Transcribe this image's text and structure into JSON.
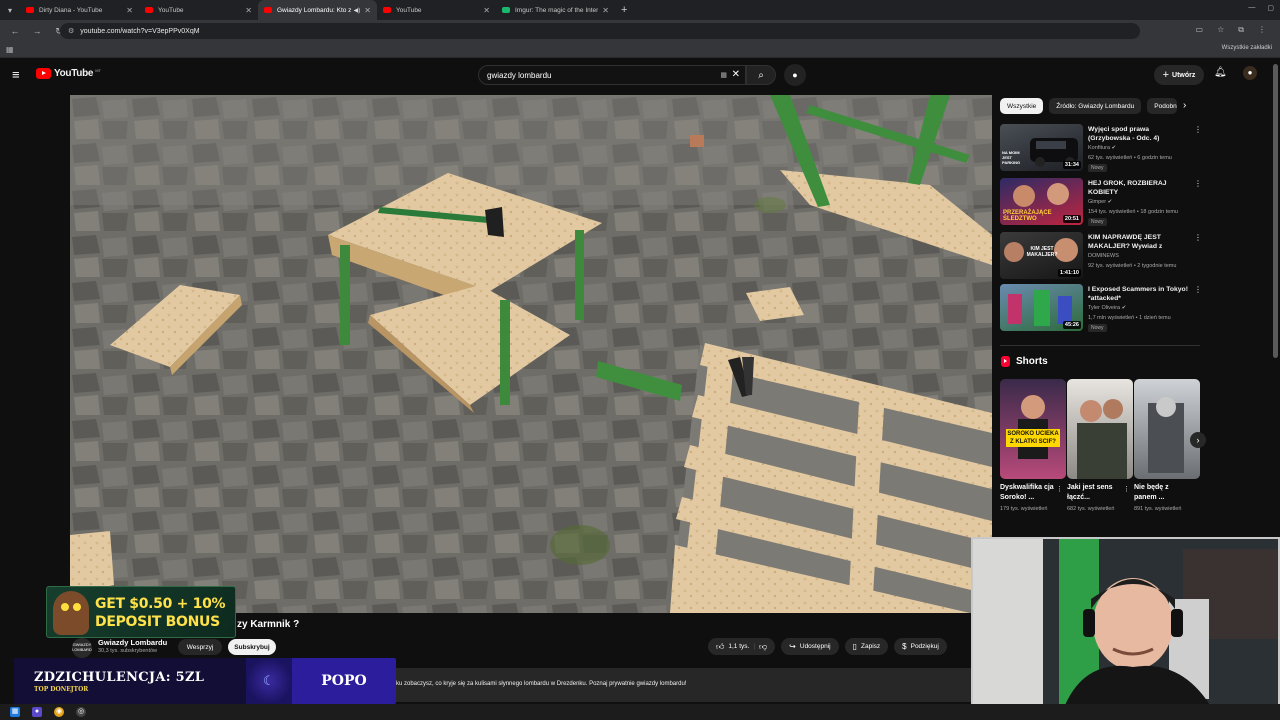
{
  "browser": {
    "tabs": [
      {
        "title": "Dirty Diana - YouTube",
        "active": false
      },
      {
        "title": "YouTube",
        "active": false
      },
      {
        "title": "Gwiazdy Lombardu: Kto zb",
        "active": true
      },
      {
        "title": "YouTube",
        "active": false
      },
      {
        "title": "Imgur: The magic of the Interne",
        "active": false
      }
    ],
    "new_tab": "+",
    "url": "youtube.com/watch?v=V3epPPv0XqM",
    "bookmarks_all": "Wszystkie zakładki"
  },
  "header": {
    "logo_text": "YouTube",
    "logo_country": "MT",
    "search_value": "gwiazdy lombardu",
    "create_label": "Utwórz"
  },
  "video": {
    "title": "zy Karmnik ?",
    "channel_name": "Gwiazdy Lombardu",
    "channel_subs": "30,3 tys. subskrybentów",
    "channel_avatar_text": "GWIAZDY LOMBARDU",
    "support_label": "Wesprzyj",
    "subscribe_label": "Subskrybuj",
    "like_count": "1,1 tys.",
    "share_label": "Udostępnij",
    "save_label": "Zapisz",
    "thanks_label": "Podziękuj",
    "description": "ku zobaczysz, co kryje się za kulisami słynnego lombardu w Drezdenku. Poznaj prywatnie gwiazdy lombardu!"
  },
  "overlays": {
    "promo_line1": "GET $0.50 + 10%",
    "promo_line2": "DEPOSIT BONUS",
    "donor_amount": "ZDZICHULENCJA: 5ZL",
    "donor_tag": "TOP DONEJTOR",
    "donor_name": "POPO"
  },
  "sidebar": {
    "chips": [
      "Wszystkie",
      "Źródło: Gwiazdy Lombardu",
      "Podobne"
    ],
    "recommendations": [
      {
        "title": "Wyjęci spod prawa (Grzybowska - Odc. 4)",
        "channel": "Konfitura",
        "meta": "62 tys. wyświetleń • 6 godzin temu",
        "badge": "Nowy",
        "duration": "31:34",
        "thumb_text": "NA MOIM JEST PARKING"
      },
      {
        "title": "HEJ GROK, ROZBIERAJ KOBIETY",
        "channel": "Gimper",
        "meta": "154 tys. wyświetleń • 18 godzin temu",
        "badge": "Nowy",
        "duration": "20:51",
        "thumb_text": "PRZERAŻAJĄCE ŚLEDZTWO"
      },
      {
        "title": "KIM NAPRAWDĘ JEST MAKALJER? Wywiad z Legend...",
        "channel": "DOMINEWS",
        "meta": "92 tys. wyświetleń • 2 tygodnie temu",
        "badge": "",
        "duration": "1:41:10",
        "thumb_text": "KIM JEST MAKALJER?"
      },
      {
        "title": "I Exposed Scammers in Tokyo! *attacked*",
        "channel": "Tyler Oliveira",
        "meta": "1,7 mln wyświetleń • 1 dzień temu",
        "badge": "Nowy",
        "duration": "45:26",
        "thumb_text": ""
      }
    ],
    "shorts_title": "Shorts",
    "shorts": [
      {
        "title": "Dyskwalifika cja Soroko! ...",
        "views": "179 tys. wyświetleń",
        "caption": "SOROKO UCIEKA Z KLATKI SCIF?"
      },
      {
        "title": "Jaki jest sens łączć...",
        "views": "682 tys. wyświetleń",
        "caption": ""
      },
      {
        "title": "Nie będę z panem ...",
        "views": "891 tys. wyświetleń",
        "caption": ""
      }
    ]
  }
}
